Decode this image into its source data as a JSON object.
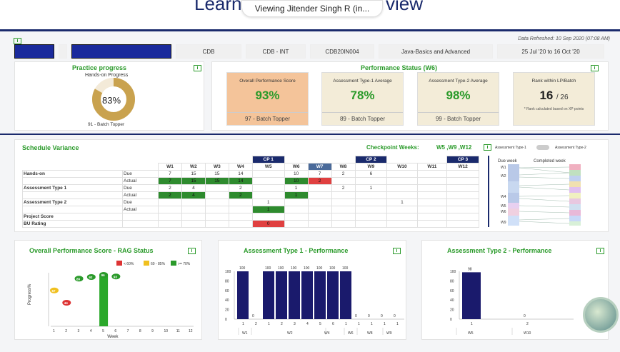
{
  "header": {
    "title_left": "Learn",
    "title_right": "view",
    "viewing": "Viewing Jitender Singh R (in..."
  },
  "refresh": "Data Refreshed: 10 Sep 2020 (07:08 AM)",
  "infobar": [
    "CDB",
    "CDB - INT",
    "CDB20IN004",
    "Java-Basics and Advanced",
    "25 Jul '20 to 16 Oct '20"
  ],
  "practice": {
    "title": "Practice progress",
    "sub": "Hands-on Progress",
    "percent": "83%",
    "fraction": 0.83,
    "footer": "91 - Batch Topper"
  },
  "perf": {
    "title": "Performance Status (W6)",
    "boxes": [
      {
        "label": "Overall Performance Score",
        "value": "93%",
        "footer": "97 - Batch Topper",
        "color": "#f4c49a"
      },
      {
        "label": "Assessment Type-1 Average",
        "value": "78%",
        "footer": "89 - Batch Topper",
        "color": "#f3ecd8"
      },
      {
        "label": "Assessment Type-2 Average",
        "value": "98%",
        "footer": "99 - Batch Topper",
        "color": "#f3ecd8"
      },
      {
        "label": "Rank within LP/Batch",
        "value": "16",
        "value2": "/ 26",
        "note": "* Rank calculated based on XP points",
        "color": "#f3ecd8"
      }
    ]
  },
  "schedule": {
    "title": "Schedule Variance",
    "checkpoint_label": "Checkpoint Weeks:",
    "checkpoint_weeks": "W5 ,W9 ,W12",
    "toggle_left": "Assessment Type-1",
    "toggle_right": "Assessment Type-2",
    "due_week": "Due week",
    "completed_week": "Completed week",
    "cp": [
      "CP 1",
      "CP 2",
      "CP 3"
    ],
    "weeks": [
      "W1",
      "W2",
      "W3",
      "W4",
      "W5",
      "W6",
      "W7",
      "W8",
      "W9",
      "W10",
      "W11",
      "W12"
    ],
    "rows": [
      {
        "name": "Hands-on",
        "sub": "Due",
        "cells": [
          "7",
          "15",
          "15",
          "14",
          "",
          "10",
          "7",
          "2",
          "6",
          "",
          "",
          ""
        ]
      },
      {
        "name": "",
        "sub": "Actual",
        "cells": [
          "7",
          "15",
          "15",
          "14",
          "",
          "10",
          "2",
          "",
          "",
          "",
          "",
          ""
        ]
      },
      {
        "name": "Assessment Type 1",
        "sub": "Due",
        "cells": [
          "2",
          "4",
          "",
          "2",
          "",
          "1",
          "",
          "2",
          "1",
          "",
          "",
          ""
        ]
      },
      {
        "name": "",
        "sub": "Actual",
        "cells": [
          "2",
          "4",
          "",
          "2",
          "",
          "1",
          "",
          "",
          "",
          "",
          "",
          ""
        ]
      },
      {
        "name": "Assessment Type 2",
        "sub": "Due",
        "cells": [
          "",
          "",
          "",
          "",
          "1",
          "",
          "",
          "",
          "",
          "1",
          "",
          ""
        ]
      },
      {
        "name": "",
        "sub": "Actual",
        "cells": [
          "",
          "",
          "",
          "",
          "1",
          "",
          "",
          "",
          "",
          "",
          "",
          ""
        ]
      },
      {
        "name": "Project Score",
        "sub": "",
        "cells": [
          "",
          "",
          "",
          "",
          "",
          "",
          "",
          "",
          "",
          "",
          "",
          ""
        ]
      },
      {
        "name": "BU Rating",
        "sub": "",
        "cells": [
          "",
          "",
          "",
          "",
          "0",
          "",
          "",
          "",
          "",
          "",
          "",
          ""
        ]
      }
    ]
  },
  "rag": {
    "title": "Overall Performance Score - RAG Status",
    "legend": [
      "< 60%",
      "60 - 85%",
      ">= 70%"
    ],
    "ylabel": "Progress%",
    "xlabel": "Week",
    "chart_data": {
      "type": "scatter",
      "x": [
        1,
        2,
        3,
        4,
        5,
        6
      ],
      "y": [
        67,
        44,
        89,
        92,
        96,
        93
      ],
      "bar_week": 5,
      "bar_value": 96,
      "xticks": [
        "1",
        "2",
        "3",
        "4",
        "5",
        "6",
        "7",
        "8",
        "9",
        "10",
        "11",
        "12"
      ]
    }
  },
  "at1": {
    "title": "Assessment Type 1 - Performance",
    "chart_data": {
      "type": "bar",
      "values": [
        100,
        0,
        100,
        100,
        100,
        100,
        100,
        100,
        100,
        0,
        0,
        0,
        0
      ],
      "xticks": [
        "1",
        "2",
        "1",
        "2",
        "3",
        "4",
        "5",
        "6",
        "1",
        "1",
        "1",
        "1",
        "1"
      ],
      "groups": [
        "W1",
        "W2",
        "W4",
        "W6",
        "W8",
        "W9"
      ]
    }
  },
  "at2": {
    "title": "Assessment Type 2 - Performance",
    "chart_data": {
      "type": "bar",
      "values": [
        98,
        0
      ],
      "xticks": [
        "1",
        "2"
      ],
      "groups": [
        "W5",
        "W10"
      ]
    }
  }
}
